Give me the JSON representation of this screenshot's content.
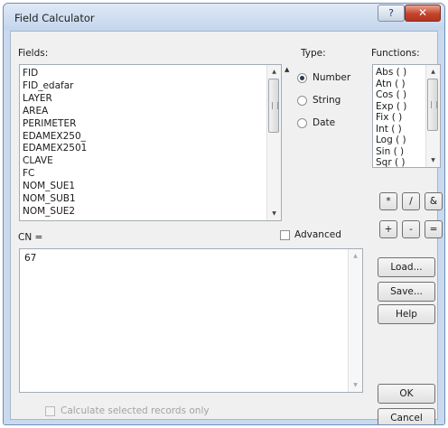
{
  "window": {
    "title": "Field Calculator",
    "help_glyph": "?",
    "close_glyph": "✕"
  },
  "fields": {
    "label": "Fields:",
    "items": [
      "FID",
      "FID_edafar",
      "LAYER",
      "AREA",
      "PERIMETER",
      "EDAMEX250_",
      "EDAMEX2501",
      "CLAVE",
      "FC",
      "NOM_SUE1",
      "NOM_SUB1",
      "NOM_SUE2"
    ]
  },
  "type": {
    "label": "Type:",
    "options": [
      {
        "label": "Number",
        "selected": true
      },
      {
        "label": "String",
        "selected": false
      },
      {
        "label": "Date",
        "selected": false
      }
    ]
  },
  "functions": {
    "label": "Functions:",
    "items": [
      "Abs ( )",
      "Atn ( )",
      "Cos ( )",
      "Exp ( )",
      "Fix ( )",
      "Int ( )",
      "Log ( )",
      "Sin ( )",
      "Sqr ( )"
    ]
  },
  "operators": {
    "row1": [
      "*",
      "/",
      "&"
    ],
    "row2": [
      "+",
      "-",
      "="
    ]
  },
  "advanced": {
    "label": "Advanced",
    "checked": false
  },
  "expression": {
    "label": "CN =",
    "value": "67"
  },
  "buttons": {
    "load": "Load...",
    "save": "Save...",
    "help": "Help",
    "ok": "OK",
    "cancel": "Cancel"
  },
  "calc_selected": {
    "label": "Calculate selected records only",
    "enabled": false,
    "checked": false
  },
  "colors": {
    "title_gradient_top": "#dfe9f6",
    "close_button": "#c5432a",
    "dialog_bg": "#f0f0f0"
  }
}
